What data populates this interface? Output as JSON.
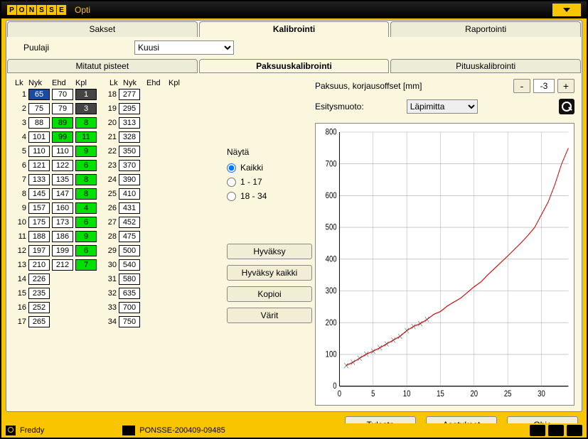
{
  "header": {
    "app": "Opti"
  },
  "tabs": {
    "main": [
      "Sakset",
      "Kalibrointi",
      "Raportointi"
    ],
    "sub": [
      "Mitatut pisteet",
      "Paksuuskalibrointi",
      "Pituuskalibrointi"
    ]
  },
  "species": {
    "label": "Puulaji",
    "value": "Kuusi"
  },
  "table": {
    "headers": [
      "Lk",
      "Nyk",
      "Ehd",
      "Kpl"
    ],
    "rows": [
      {
        "lk": 1,
        "nyk": 65,
        "ehd": 70,
        "kpl": 1,
        "kplcls": "dark",
        "nykcls": "sel"
      },
      {
        "lk": 2,
        "nyk": 75,
        "ehd": 79,
        "kpl": 3,
        "kplcls": "dark"
      },
      {
        "lk": 3,
        "nyk": 88,
        "ehd": 89,
        "kpl": 8,
        "ehdcls": "green",
        "kplcls": "green"
      },
      {
        "lk": 4,
        "nyk": 101,
        "ehd": 99,
        "kpl": 11,
        "ehdcls": "green",
        "kplcls": "green"
      },
      {
        "lk": 5,
        "nyk": 110,
        "ehd": 110,
        "kpl": 9,
        "kplcls": "green"
      },
      {
        "lk": 6,
        "nyk": 121,
        "ehd": 122,
        "kpl": 6,
        "kplcls": "green"
      },
      {
        "lk": 7,
        "nyk": 133,
        "ehd": 135,
        "kpl": 8,
        "kplcls": "green"
      },
      {
        "lk": 8,
        "nyk": 145,
        "ehd": 147,
        "kpl": 8,
        "kplcls": "green"
      },
      {
        "lk": 9,
        "nyk": 157,
        "ehd": 160,
        "kpl": 4,
        "kplcls": "green"
      },
      {
        "lk": 10,
        "nyk": 175,
        "ehd": 173,
        "kpl": 6,
        "kplcls": "green"
      },
      {
        "lk": 11,
        "nyk": 188,
        "ehd": 186,
        "kpl": 9,
        "kplcls": "green"
      },
      {
        "lk": 12,
        "nyk": 197,
        "ehd": 199,
        "kpl": 6,
        "kplcls": "green"
      },
      {
        "lk": 13,
        "nyk": 210,
        "ehd": 212,
        "kpl": 7,
        "kplcls": "green"
      },
      {
        "lk": 14,
        "nyk": 226
      },
      {
        "lk": 15,
        "nyk": 235
      },
      {
        "lk": 16,
        "nyk": 252
      },
      {
        "lk": 17,
        "nyk": 265
      },
      {
        "lk": 18,
        "nyk": 277
      },
      {
        "lk": 19,
        "nyk": 295
      },
      {
        "lk": 20,
        "nyk": 313
      },
      {
        "lk": 21,
        "nyk": 328
      },
      {
        "lk": 22,
        "nyk": 350
      },
      {
        "lk": 23,
        "nyk": 370
      },
      {
        "lk": 24,
        "nyk": 390
      },
      {
        "lk": 25,
        "nyk": 410
      },
      {
        "lk": 26,
        "nyk": 431
      },
      {
        "lk": 27,
        "nyk": 452
      },
      {
        "lk": 28,
        "nyk": 475
      },
      {
        "lk": 29,
        "nyk": 500
      },
      {
        "lk": 30,
        "nyk": 540
      },
      {
        "lk": 31,
        "nyk": 580
      },
      {
        "lk": 32,
        "nyk": 635
      },
      {
        "lk": 33,
        "nyk": 700
      },
      {
        "lk": 34,
        "nyk": 750
      }
    ]
  },
  "show": {
    "label": "Näytä",
    "options": [
      "Kaikki",
      "1 - 17",
      "18 - 34"
    ],
    "selected": "Kaikki"
  },
  "offset": {
    "label": "Paksuus, korjausoffset [mm]",
    "minus": "-",
    "plus": "+",
    "value": "-3"
  },
  "present": {
    "label": "Esitysmuoto:",
    "value": "Läpimitta"
  },
  "buttons": {
    "accept": "Hyväksy",
    "accept_all": "Hyväksy kaikki",
    "copy": "Kopioi",
    "colors": "Värit",
    "print": "Tulosta",
    "settings": "Asetukset",
    "help": "Ohje"
  },
  "status": {
    "user": "Freddy",
    "machine": "PONSSE-200409-09485"
  },
  "chart_data": {
    "type": "line",
    "xlabel": "",
    "ylabel": "",
    "xlim": [
      0,
      34
    ],
    "ylim": [
      0,
      800
    ],
    "xticks": [
      0,
      5,
      10,
      15,
      20,
      25,
      30
    ],
    "yticks": [
      0,
      100,
      200,
      300,
      400,
      500,
      600,
      700,
      800
    ],
    "series": [
      {
        "name": "Nyk",
        "x": [
          1,
          2,
          3,
          4,
          5,
          6,
          7,
          8,
          9,
          10,
          11,
          12,
          13,
          14,
          15,
          16,
          17,
          18,
          19,
          20,
          21,
          22,
          23,
          24,
          25,
          26,
          27,
          28,
          29,
          30,
          31,
          32,
          33,
          34
        ],
        "y": [
          65,
          75,
          88,
          101,
          110,
          121,
          133,
          145,
          157,
          175,
          188,
          197,
          210,
          226,
          235,
          252,
          265,
          277,
          295,
          313,
          328,
          350,
          370,
          390,
          410,
          431,
          452,
          475,
          500,
          540,
          580,
          635,
          700,
          750
        ]
      }
    ],
    "markers_end_index": 13
  }
}
